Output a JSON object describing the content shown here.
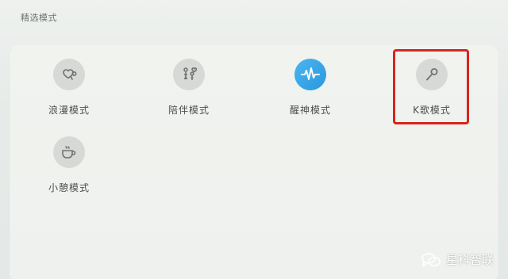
{
  "section": {
    "title": "精选模式"
  },
  "modes": [
    {
      "label": "浪漫模式",
      "icon": "heart-balloon-icon",
      "active": false
    },
    {
      "label": "陪伴模式",
      "icon": "companion-people-icon",
      "active": false
    },
    {
      "label": "醒神模式",
      "icon": "pulse-wave-icon",
      "active": true
    },
    {
      "label": "K歌模式",
      "icon": "microphone-icon",
      "active": false
    },
    {
      "label": "小憩模式",
      "icon": "coffee-cup-icon",
      "active": false
    }
  ],
  "colors": {
    "active_accent": "#2a97e0",
    "icon_bg": "#d7d9d6",
    "highlight": "#d6261d"
  },
  "watermark": {
    "text": "星科智联"
  }
}
